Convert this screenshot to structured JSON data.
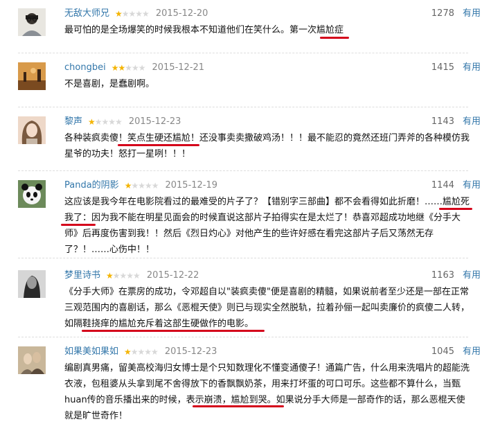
{
  "reviews": [
    {
      "author": "无敌大师兄",
      "stars": 1,
      "date": "2015-12-20",
      "votes": "1278",
      "useful": "有用",
      "text": "最可怕的是全场爆笑的时候我根本不知道他们在笑什么。第一次尴尬症"
    },
    {
      "author": "chongbei",
      "stars": 2,
      "date": "2015-12-21",
      "votes": "1415",
      "useful": "有用",
      "text": "不是喜剧，是蠢剧啊。"
    },
    {
      "author": "黎声",
      "stars": 1,
      "date": "2015-12-23",
      "votes": "1143",
      "useful": "有用",
      "text": "各种装疯卖傻！笑点生硬还尴尬！还没事卖卖撒破鸡汤！！！最不能忍的竟然还班门弄斧的各种模仿我星爷的功夫！怒打一星咧！！！"
    },
    {
      "author": "Panda的阴影",
      "stars": 1,
      "date": "2015-12-19",
      "votes": "1144",
      "useful": "有用",
      "text": "这应该是我今年在电影院看过的最难受的片子了？【错别字三部曲】都不会看得如此折磨！……尴尬死我了：因为我不能在明星见面会的时候直说这部片子拍得实在是太烂了！恭喜邓超成功地继《分手大师》后再度伤害到我！！然后《烈日灼心》对他产生的些许好感在看完这部片子后又荡然无存了？！……心伤中！！"
    },
    {
      "author": "梦里诗书",
      "stars": 1,
      "date": "2015-12-22",
      "votes": "1163",
      "useful": "有用",
      "text": "《分手大师》在票房的成功，令邓超自以\"装疯卖傻\"便是喜剧的精髓，如果说前者至少还是一部在正常三观范围内的喜剧话，那么《恶棍天使》则已与现实全然脱轨，拉着孙俪一起叫卖廉价的疯傻二人转，如隔鞋挠痒的尴尬充斥着这部生硬做作的电影。"
    },
    {
      "author": "如果美如果如",
      "stars": 1,
      "date": "2015-12-23",
      "votes": "1045",
      "useful": "有用",
      "text": "编剧真男痛，留美高校海归女博士是个只知数理化不懂变通傻子！通篇广告，什么用来洗唱片的超能洗衣液，包租婆从头拿到尾不舍得放下的香飘飘奶茶，用来打坏蛋的可口可乐。这些都不算什么，当甄huan传的音乐播出来的时候，表示崩溃，尴尬到哭。如果说分手大师是一部奇作的话，那么恶棍天使就是旷世奇作！"
    }
  ],
  "colors": {
    "link": "#3377aa",
    "star_on": "#f4b400",
    "star_off": "#d8d8d8",
    "underline": "#d4001a"
  }
}
